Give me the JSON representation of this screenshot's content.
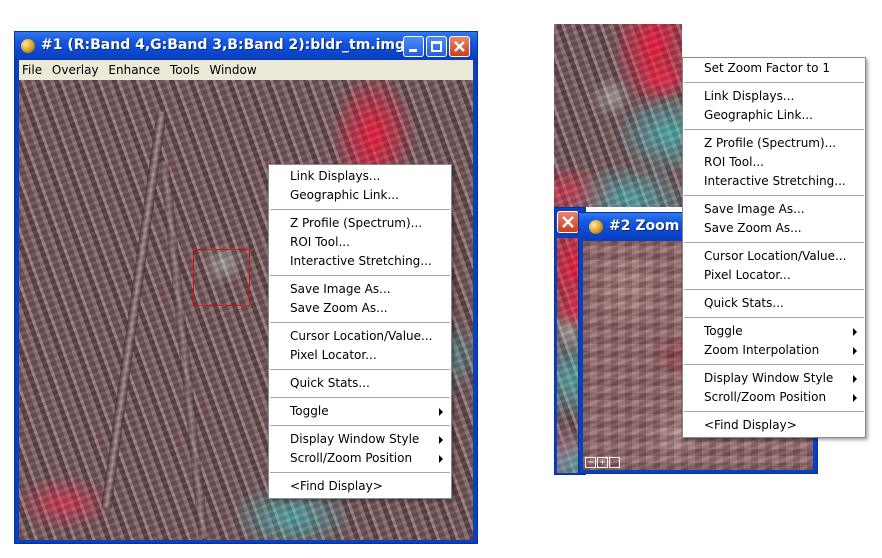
{
  "window1": {
    "title": "#1 (R:Band 4,G:Band 3,B:Band 2):bldr_tm.img",
    "menu": [
      "File",
      "Overlay",
      "Enhance",
      "Tools",
      "Window"
    ]
  },
  "context_menu_1": {
    "groups": [
      [
        "Link Displays...",
        "Geographic Link..."
      ],
      [
        "Z Profile (Spectrum)...",
        "ROI Tool...",
        "Interactive Stretching..."
      ],
      [
        "Save Image As...",
        "Save Zoom As..."
      ],
      [
        "Cursor Location/Value...",
        "Pixel Locator..."
      ],
      [
        "Quick Stats..."
      ],
      [
        "Toggle"
      ],
      [
        "Display Window Style",
        "Scroll/Zoom Position"
      ],
      [
        "<Find Display>"
      ]
    ]
  },
  "zoom_window": {
    "title": "#2 Zoom [4"
  },
  "context_menu_2": {
    "groups": [
      [
        "Set Zoom Factor to 1"
      ],
      [
        "Link Displays...",
        "Geographic Link..."
      ],
      [
        "Z Profile (Spectrum)...",
        "ROI Tool...",
        "Interactive Stretching..."
      ],
      [
        "Save Image As...",
        "Save Zoom As..."
      ],
      [
        "Cursor Location/Value...",
        "Pixel Locator..."
      ],
      [
        "Quick Stats..."
      ],
      [
        "Toggle",
        "Zoom Interpolation"
      ],
      [
        "Display Window Style",
        "Scroll/Zoom Position"
      ],
      [
        "<Find Display>"
      ]
    ]
  },
  "colors": {
    "titlebar": "#0b47cf",
    "menubar": "#ece9d8",
    "highlight_red": "#ff1a3c",
    "highlight_cyan": "#3cdcdc"
  }
}
